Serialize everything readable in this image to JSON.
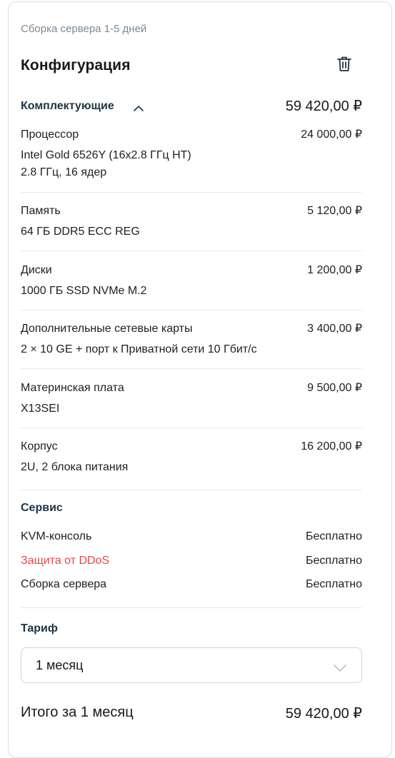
{
  "build_time": "Сборка сервера 1-5 дней",
  "title": "Конфигурация",
  "components": {
    "label": "Комплектующие",
    "total": "59 420,00 ₽",
    "items": [
      {
        "name": "Процессор",
        "price": "24 000,00 ₽",
        "desc": "Intel Gold 6526Y (16x2.8 ГГц HT)",
        "desc2": "2.8 ГГц, 16 ядер"
      },
      {
        "name": "Память",
        "price": "5 120,00 ₽",
        "desc": "64 ГБ DDR5 ECC REG"
      },
      {
        "name": "Диски",
        "price": "1 200,00 ₽",
        "desc": "1000 ГБ SSD NVMe M.2"
      },
      {
        "name": "Дополнительные сетевые карты",
        "price": "3 400,00 ₽",
        "desc": "2 × 10 GE + порт к Приватной сети 10 Гбит/с"
      },
      {
        "name": "Материнская плата",
        "price": "9 500,00 ₽",
        "desc": "X13SEI"
      },
      {
        "name": "Корпус",
        "price": "16 200,00 ₽",
        "desc": "2U, 2 блока питания"
      }
    ]
  },
  "service": {
    "label": "Сервис",
    "items": [
      {
        "name": "KVM-консоль",
        "price": "Бесплатно"
      },
      {
        "name": "Защита от DDoS",
        "price": "Бесплатно"
      },
      {
        "name": "Сборка сервера",
        "price": "Бесплатно"
      }
    ]
  },
  "tariff": {
    "label": "Тариф",
    "selected": "1 месяц"
  },
  "summary": {
    "label": "Итого за 1 месяц",
    "value": "59 420,00 ₽"
  },
  "colors": {
    "accent_red": "#e5484d",
    "section_heading": "#1d3446",
    "muted": "#7a8a96"
  },
  "icons": [
    "trash-icon",
    "chevron-up-icon",
    "chevron-down-icon"
  ]
}
